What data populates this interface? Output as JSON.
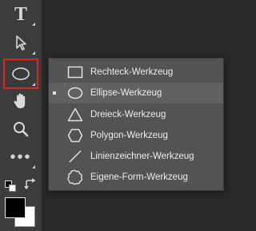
{
  "toolbar": {
    "tools": [
      {
        "name": "type-tool",
        "icon": "type-icon",
        "glyph": "T"
      },
      {
        "name": "path-selection-tool",
        "icon": "arrow-cursor-icon"
      },
      {
        "name": "ellipse-tool",
        "icon": "ellipse-icon",
        "active": true
      },
      {
        "name": "hand-tool",
        "icon": "hand-icon"
      },
      {
        "name": "zoom-tool",
        "icon": "magnifier-icon"
      },
      {
        "name": "more-tools",
        "icon": "ellipsis-icon",
        "glyph": "•••"
      }
    ],
    "colors": {
      "foreground": "#000000",
      "background": "#ffffff",
      "active_outline": "#e8201f"
    }
  },
  "flyout": {
    "items": [
      {
        "label": "Rechteck-Werkzeug",
        "icon": "rectangle-icon",
        "selected": false
      },
      {
        "label": "Ellipse-Werkzeug",
        "icon": "ellipse-icon",
        "selected": true
      },
      {
        "label": "Dreieck-Werkzeug",
        "icon": "triangle-icon",
        "selected": false
      },
      {
        "label": "Polygon-Werkzeug",
        "icon": "hexagon-icon",
        "selected": false
      },
      {
        "label": "Linienzeichner-Werkzeug",
        "icon": "line-icon",
        "selected": false
      },
      {
        "label": "Eigene-Form-Werkzeug",
        "icon": "custom-shape-icon",
        "selected": false
      }
    ]
  }
}
